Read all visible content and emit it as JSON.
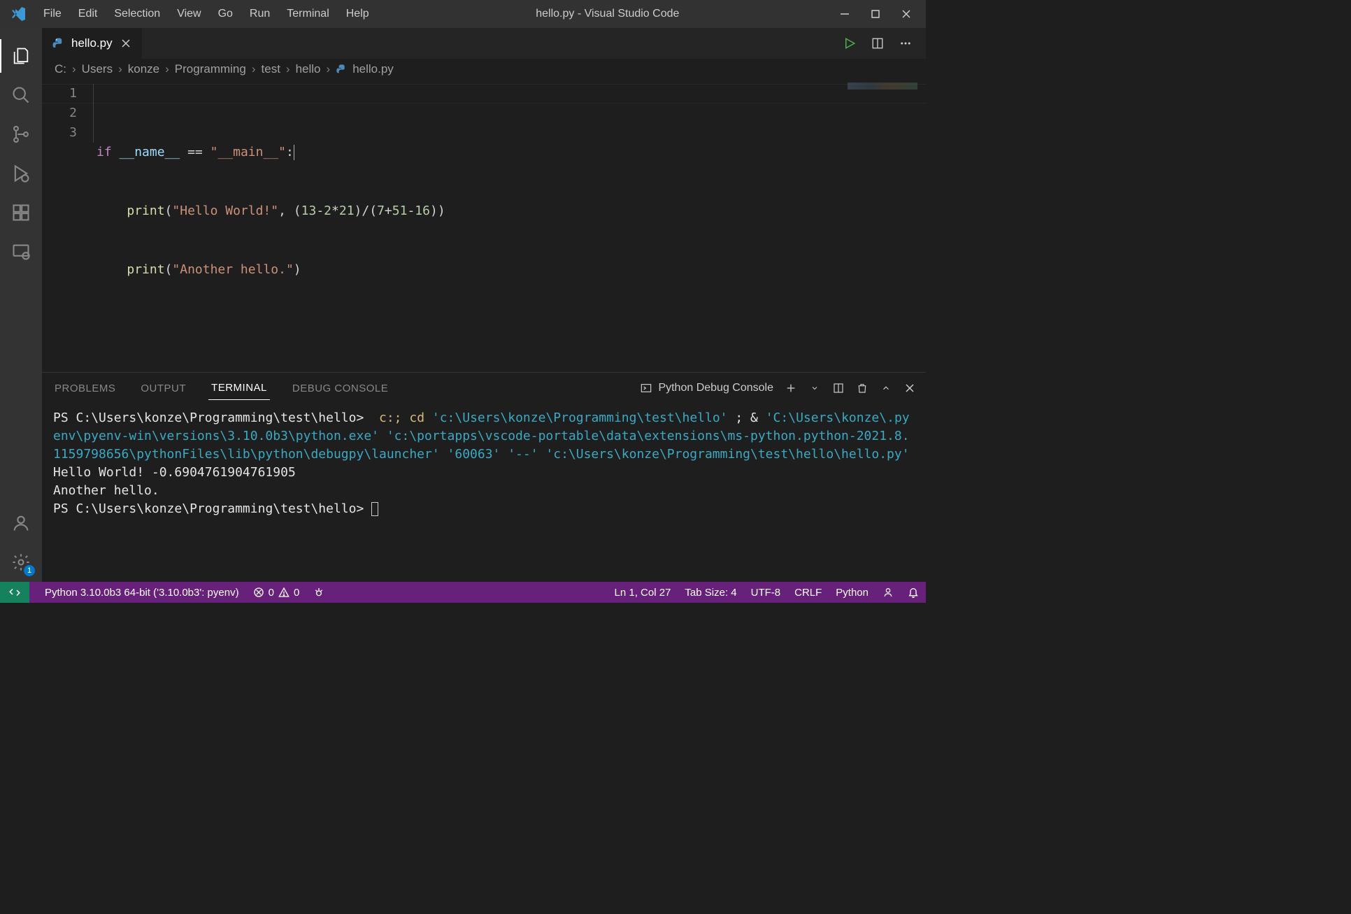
{
  "window": {
    "title": "hello.py - Visual Studio Code"
  },
  "menu": {
    "file": "File",
    "edit": "Edit",
    "selection": "Selection",
    "view": "View",
    "go": "Go",
    "run": "Run",
    "terminal": "Terminal",
    "help": "Help"
  },
  "activitybar": {
    "gear_badge": "1"
  },
  "tab": {
    "filename": "hello.py"
  },
  "breadcrumbs": [
    "C:",
    "Users",
    "konze",
    "Programming",
    "test",
    "hello",
    "hello.py"
  ],
  "code": {
    "line_numbers": [
      "1",
      "2",
      "3"
    ],
    "line1": {
      "kw": "if",
      "var": "__name__",
      "op": "==",
      "str": "\"__main__\"",
      "colon": ":"
    },
    "line2": {
      "fn": "print",
      "str": "\"Hello World!\"",
      "comma": ",",
      "expr_nums": [
        "13",
        "2",
        "21",
        "7",
        "51",
        "16"
      ],
      "ops": [
        "(",
        "-",
        "*",
        ")",
        "/",
        "(",
        "+",
        "-",
        ")"
      ]
    },
    "line2_full_expr": "(13-2*21)/(7+51-16))",
    "line3": {
      "fn": "print",
      "str": "\"Another hello.\""
    }
  },
  "panel": {
    "tabs": {
      "problems": "PROBLEMS",
      "output": "OUTPUT",
      "terminal": "TERMINAL",
      "debug": "DEBUG CONSOLE"
    },
    "shell_label": "Python Debug Console"
  },
  "terminal": {
    "prompt1_prefix": "PS ",
    "prompt1_path": "C:\\Users\\konze\\Programming\\test\\hello",
    "prompt1_gt": "> ",
    "cmd_start": " c:; ",
    "cd": "cd",
    "cmd_path1": " 'c:\\Users\\konze\\Programming\\test\\hello'",
    "cmd_cont1": " ; & ",
    "cmd_path2": "'C:\\Users\\konze\\.pyenv\\pyenv-win\\versions\\3.10.0b3\\python.exe' 'c:\\portapps\\vscode-portable\\data\\extensions\\ms-python.python-2021.8.1159798656\\pythonFiles\\lib\\python\\debugpy\\launcher' '60063' '--' 'c:\\Users\\konze\\Programming\\test\\hello\\hello.py'",
    "out1": "Hello World! -0.6904761904761905",
    "out2": "Another hello.",
    "prompt2_prefix": "PS ",
    "prompt2_path": "C:\\Users\\konze\\Programming\\test\\hello",
    "prompt2_gt": "> "
  },
  "status": {
    "interpreter": "Python 3.10.0b3 64-bit ('3.10.0b3': pyenv)",
    "errors": "0",
    "warnings": "0",
    "cursor": "Ln 1, Col 27",
    "spaces": "Tab Size: 4",
    "encoding": "UTF-8",
    "eol": "CRLF",
    "lang": "Python"
  }
}
